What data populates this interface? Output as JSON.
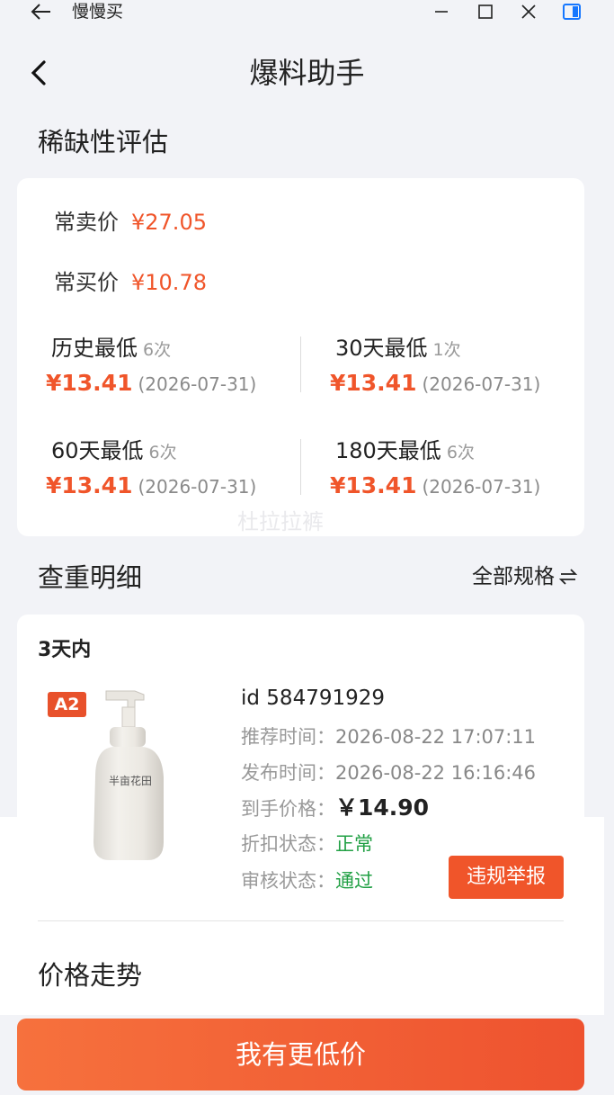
{
  "window": {
    "title": "慢慢买"
  },
  "nav": {
    "title": "爆料助手"
  },
  "scarcity": {
    "section_title": "稀缺性评估",
    "usual_sell_label": "常卖价",
    "usual_sell_value": "¥27.05",
    "usual_buy_label": "常买价",
    "usual_buy_value": "¥10.78",
    "stats": [
      {
        "name": "历史最低",
        "count": "6次",
        "price": "¥13.41",
        "date": "(2026-07-31)"
      },
      {
        "name": "30天最低",
        "count": "1次",
        "price": "¥13.41",
        "date": "(2026-07-31)"
      },
      {
        "name": "60天最低",
        "count": "6次",
        "price": "¥13.41",
        "date": "(2026-07-31)"
      },
      {
        "name": "180天最低",
        "count": "6次",
        "price": "¥13.41",
        "date": "(2026-07-31)"
      }
    ],
    "watermark": "杜拉拉裤"
  },
  "duplicate": {
    "section_title": "查重明细",
    "all_spec_label": "全部规格",
    "period": "3天内",
    "badge": "A2",
    "product_brand": "半亩花田",
    "id_text": "id 584791929",
    "recommend_label": "推荐时间：",
    "recommend_value": "2026-08-22 17:07:11",
    "publish_label": "发布时间：",
    "publish_value": "2026-08-22 16:16:46",
    "price_label": "到手价格：",
    "price_value": "￥14.90",
    "discount_label": "折扣状态：",
    "discount_value": "正常",
    "review_label": "审核状态：",
    "review_value": "通过",
    "report_label": "违规举报"
  },
  "trend": {
    "section_title": "价格走势"
  },
  "cta": {
    "label": "我有更低价"
  },
  "colors": {
    "accent": "#f0552a",
    "green": "#22a045",
    "window_ctrl_blue": "#1677ff"
  }
}
